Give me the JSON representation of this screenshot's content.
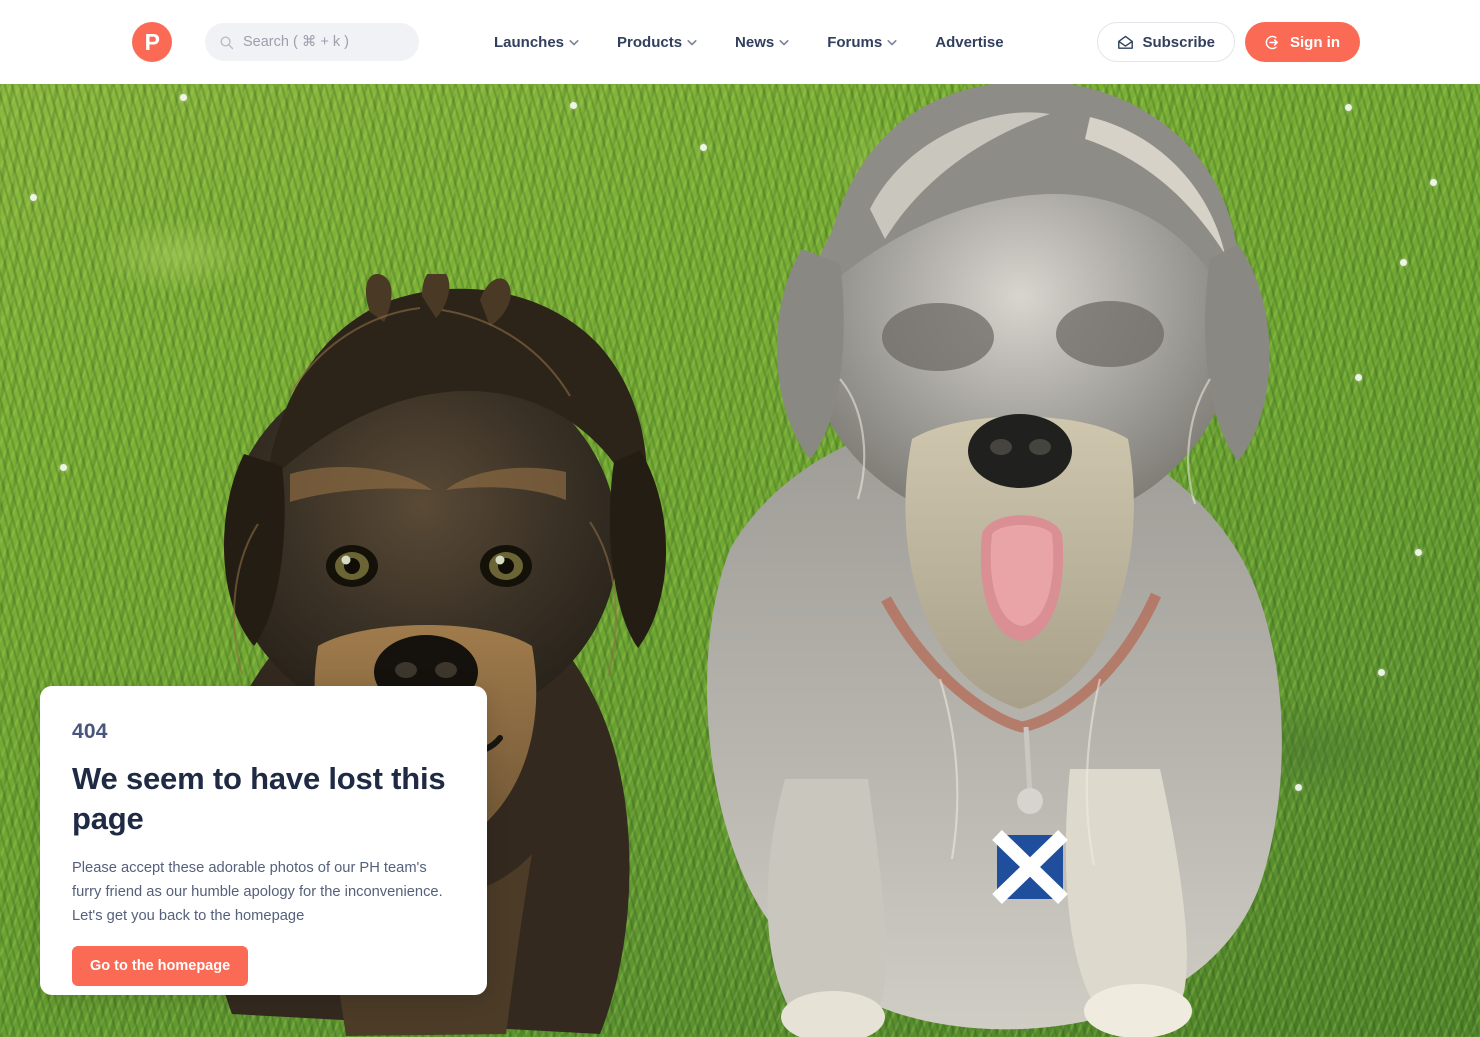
{
  "header": {
    "logo_letter": "P",
    "logo_color": "#fb6a55",
    "search": {
      "placeholder": "Search ( ⌘ + k )",
      "icon": "search-icon"
    },
    "nav": [
      {
        "label": "Launches",
        "has_dropdown": true
      },
      {
        "label": "Products",
        "has_dropdown": true
      },
      {
        "label": "News",
        "has_dropdown": true
      },
      {
        "label": "Forums",
        "has_dropdown": true
      },
      {
        "label": "Advertise",
        "has_dropdown": false
      }
    ],
    "subscribe": {
      "label": "Subscribe",
      "icon": "envelope-icon"
    },
    "signin": {
      "label": "Sign in",
      "icon": "sign-in-arrow-icon",
      "color": "#fb6a55"
    }
  },
  "hero": {
    "alt": "Two scruffy terrier dogs lying on bright green grass",
    "grass_color": "#6fa732"
  },
  "card": {
    "code": "404",
    "title": "We seem to have lost this page",
    "body": "Please accept these adorable photos of our PH team's furry friend as our humble apology for the inconvenience. Let's get you back to the homepage",
    "button_label": "Go to the homepage",
    "button_color": "#fb6a55"
  }
}
